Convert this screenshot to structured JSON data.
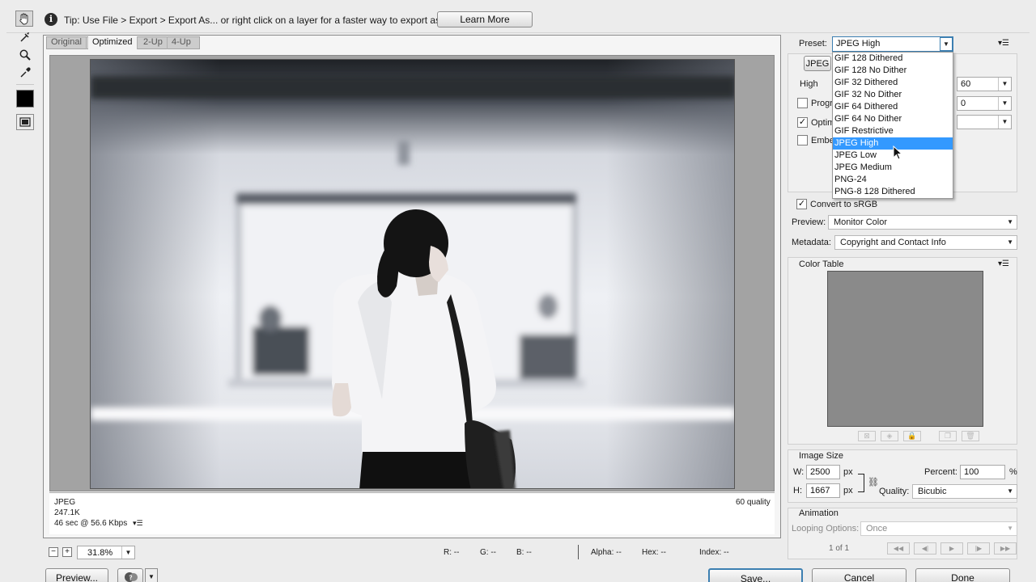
{
  "tipbar": {
    "tip_text": "Tip: Use File > Export > Export As...  or right click on a layer for a faster way to export assets",
    "learn_more_label": "Learn More"
  },
  "view_tabs": [
    "Original",
    "Optimized",
    "2-Up",
    "4-Up"
  ],
  "preview_info": {
    "format": "JPEG",
    "size": "247.1K",
    "download_time": "46 sec @ 56.6 Kbps",
    "quality_label": "60 quality"
  },
  "bottom_bar": {
    "zoom": "31.8%",
    "r_label": "R: --",
    "g_label": "G: --",
    "b_label": "B: --",
    "alpha_label": "Alpha: --",
    "hex_label": "Hex: --",
    "index_label": "Index: --"
  },
  "buttons": {
    "preview": "Preview...",
    "save": "Save...",
    "cancel": "Cancel",
    "done": "Done"
  },
  "settings": {
    "preset_label": "Preset:",
    "preset_value": "JPEG High",
    "format_value": "JPEG",
    "quality_level": "High",
    "quality_value": "60",
    "blur_value": "0",
    "progressive_label": "Progr",
    "optimized_label": "Optim",
    "embed_label": "Embe",
    "convert_srgb_label": "Convert to sRGB",
    "preview_label": "Preview:",
    "preview_value": "Monitor Color",
    "metadata_label": "Metadata:",
    "metadata_value": "Copyright and Contact Info"
  },
  "preset_options": [
    "GIF 128 Dithered",
    "GIF 128 No Dither",
    "GIF 32 Dithered",
    "GIF 32 No Dither",
    "GIF 64 Dithered",
    "GIF 64 No Dither",
    "GIF Restrictive",
    "JPEG High",
    "JPEG Low",
    "JPEG Medium",
    "PNG-24",
    "PNG-8 128 Dithered"
  ],
  "color_table": {
    "title": "Color Table"
  },
  "image_size": {
    "title": "Image Size",
    "w_label": "W:",
    "w_value": "2500",
    "h_label": "H:",
    "h_value": "1667",
    "unit": "px",
    "percent_label": "Percent:",
    "percent_value": "100",
    "percent_unit": "%",
    "quality_label": "Quality:",
    "quality_value": "Bicubic"
  },
  "animation": {
    "title": "Animation",
    "looping_label": "Looping Options:",
    "looping_value": "Once",
    "frame_counter": "1 of 1"
  },
  "colors": {
    "selection": "#3399ff",
    "save_border": "#3c7fb1"
  }
}
